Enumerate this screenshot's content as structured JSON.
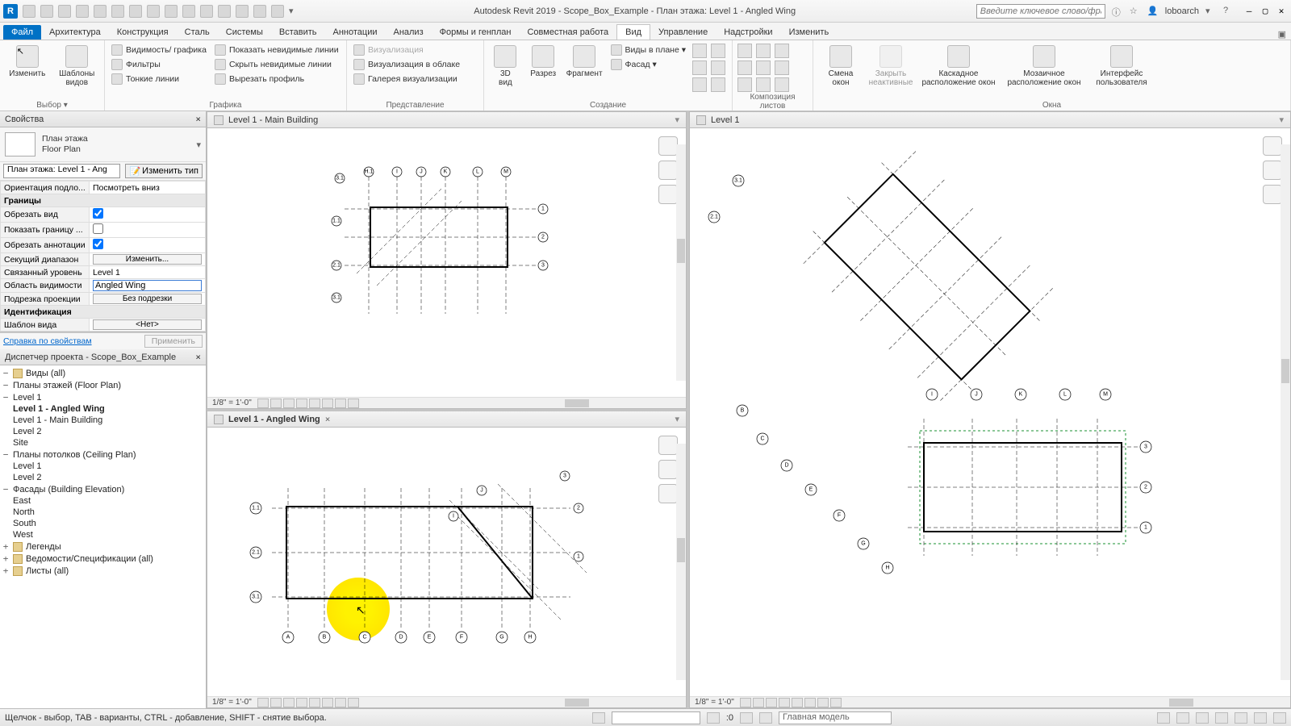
{
  "title": "Autodesk Revit 2019 - Scope_Box_Example - План этажа: Level 1 - Angled Wing",
  "searchPlaceholder": "Введите ключевое слово/фразу",
  "user": "loboarch",
  "tabs": {
    "file": "Файл",
    "list": [
      "Архитектура",
      "Конструкция",
      "Сталь",
      "Системы",
      "Вставить",
      "Аннотации",
      "Анализ",
      "Формы и генплан",
      "Совместная работа",
      "Вид",
      "Управление",
      "Надстройки",
      "Изменить"
    ],
    "active": "Вид"
  },
  "ribbon": {
    "select": {
      "modify": "Изменить",
      "templates": "Шаблоны\nвидов",
      "label": "Выбор ▾"
    },
    "graphics": {
      "vis": "Видимость/ графика",
      "filters": "Фильтры",
      "thin": "Тонкие линии",
      "showH": "Показать невидимые линии",
      "hideH": "Скрыть невидимые линии",
      "cutP": "Вырезать профиль",
      "label": "Графика"
    },
    "present": {
      "render": "Визуализация",
      "cloud": "Визуализация в облаке",
      "gallery": "Галерея визуализации",
      "label": "Представление"
    },
    "create": {
      "v3d": "3D\nвид",
      "section": "Разрез",
      "fragment": "Фрагмент",
      "planviews": "Виды в плане ▾",
      "elev": "Фасад ▾",
      "label": "Создание"
    },
    "sheets": {
      "label": "Композиция листов"
    },
    "windows": {
      "switch": "Смена\nокон",
      "closeInactive": "Закрыть\nнеактивные",
      "cascade": "Каскадное\nрасположение окон",
      "tile": "Мозаичное\nрасположение окон",
      "ui": "Интерфейс\nпользователя",
      "label": "Окна"
    }
  },
  "props": {
    "panelTitle": "Свойства",
    "family": "План этажа\nFloor Plan",
    "typeSel": "План этажа: Level 1 - Ang",
    "editType": "Изменить тип",
    "rows": [
      {
        "k": "Ориентация подло...",
        "v": "Посмотреть вниз",
        "btn": false
      },
      {
        "cat": "Границы"
      },
      {
        "k": "Обрезать вид",
        "chk": true
      },
      {
        "k": "Показать границу ...",
        "chk": false
      },
      {
        "k": "Обрезать аннотации",
        "chk": true
      },
      {
        "k": "Секущий диапазон",
        "v": "Изменить...",
        "btn": true
      },
      {
        "k": "Связанный уровень",
        "v": "Level 1"
      },
      {
        "k": "Область видимости",
        "v": "Angled Wing",
        "sel": true
      },
      {
        "k": "Подрезка проекции",
        "v": "Без подрезки",
        "btn": true
      },
      {
        "cat": "Идентификация"
      },
      {
        "k": "Шаблон вида",
        "v": "<Нет>",
        "btn": true
      }
    ],
    "help": "Справка по свойствам",
    "apply": "Применить"
  },
  "browser": {
    "title": "Диспетчер проекта - Scope_Box_Example",
    "tree": [
      {
        "d": 0,
        "tw": "−",
        "ic": true,
        "t": "Виды (all)"
      },
      {
        "d": 1,
        "tw": "−",
        "t": "Планы этажей (Floor Plan)"
      },
      {
        "d": 2,
        "tw": "−",
        "t": "Level 1"
      },
      {
        "d": 3,
        "t": "Level 1 - Angled Wing",
        "bold": true
      },
      {
        "d": 3,
        "t": "Level 1 - Main Building"
      },
      {
        "d": 2,
        "t": "Level 2"
      },
      {
        "d": 2,
        "t": "Site"
      },
      {
        "d": 1,
        "tw": "−",
        "t": "Планы потолков (Ceiling Plan)"
      },
      {
        "d": 2,
        "t": "Level 1"
      },
      {
        "d": 2,
        "t": "Level 2"
      },
      {
        "d": 1,
        "tw": "−",
        "t": "Фасады (Building Elevation)"
      },
      {
        "d": 2,
        "t": "East"
      },
      {
        "d": 2,
        "t": "North"
      },
      {
        "d": 2,
        "t": "South"
      },
      {
        "d": 2,
        "t": "West"
      },
      {
        "d": 0,
        "tw": "+",
        "ic": true,
        "t": "Легенды"
      },
      {
        "d": 0,
        "tw": "+",
        "ic": true,
        "t": "Ведомости/Спецификации (all)"
      },
      {
        "d": 0,
        "tw": "+",
        "ic": true,
        "t": "Листы (all)"
      }
    ]
  },
  "views": {
    "tl": "Level 1 - Main Building",
    "bl": "Level 1 - Angled Wing",
    "r": "Level 1",
    "scale": "1/8\" = 1'-0\""
  },
  "status": {
    "hint": "Щелчок - выбор, TAB - варианты, CTRL - добавление, SHIFT - снятие выбора.",
    "zero": ":0",
    "model": "Главная модель"
  }
}
